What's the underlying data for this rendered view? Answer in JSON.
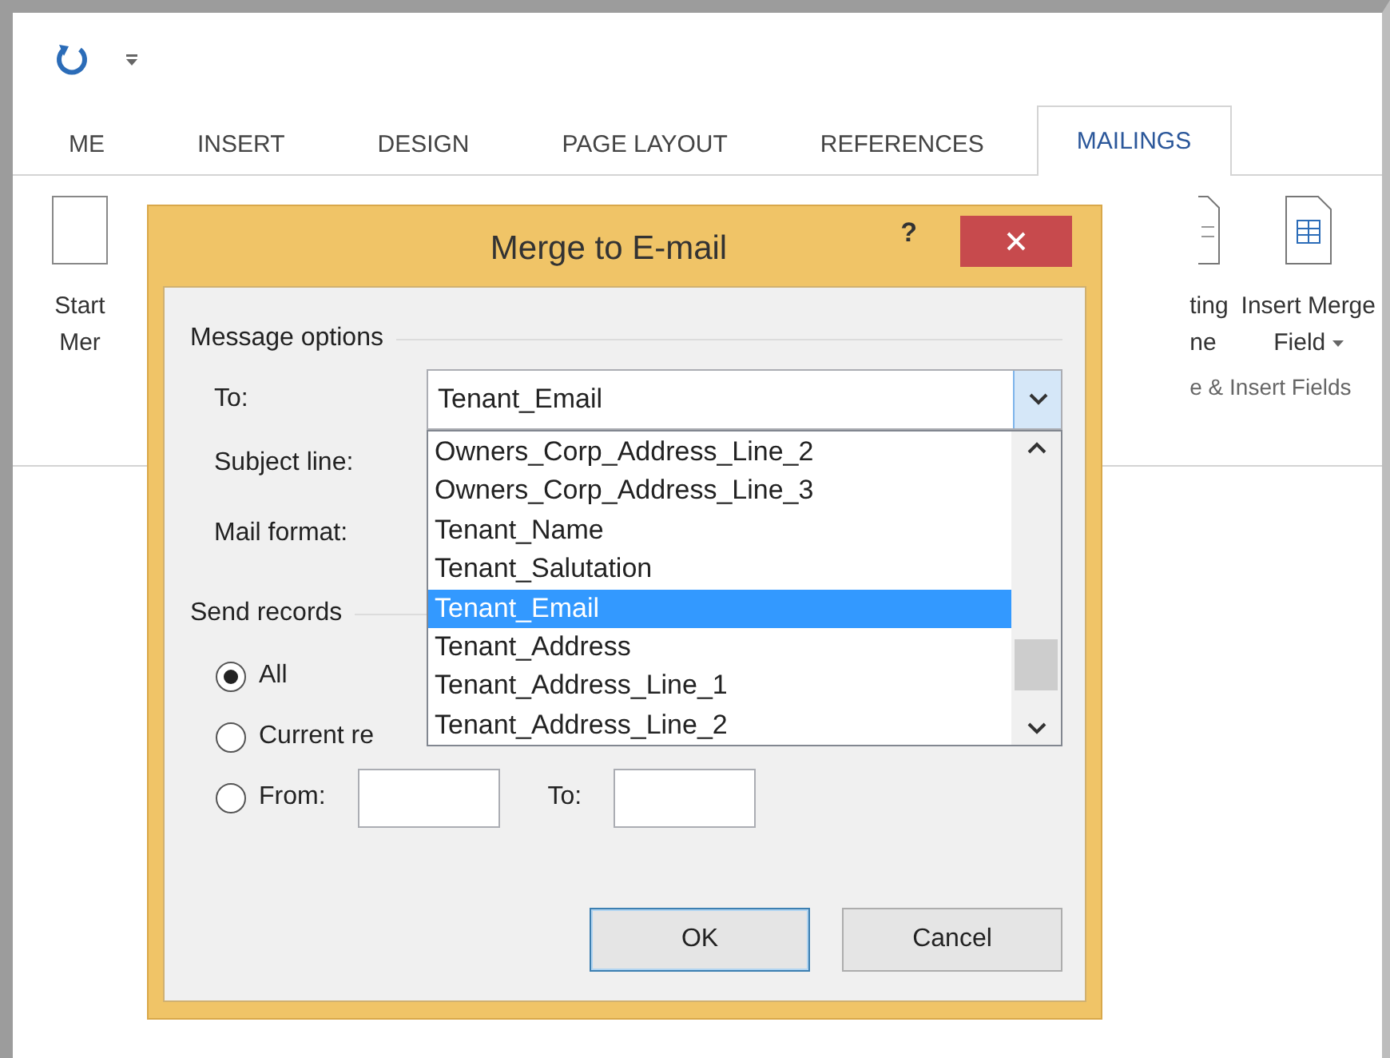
{
  "tabs": [
    {
      "label": "ME",
      "selected": false
    },
    {
      "label": "INSERT",
      "selected": false
    },
    {
      "label": "DESIGN",
      "selected": false
    },
    {
      "label": "PAGE LAYOUT",
      "selected": false
    },
    {
      "label": "REFERENCES",
      "selected": false
    },
    {
      "label": "MAILINGS",
      "selected": true
    }
  ],
  "ribbon": {
    "left_command": {
      "lines": [
        "Start",
        "Mer"
      ]
    },
    "right_commands": [
      {
        "kind": "partial",
        "lines": [
          "ting",
          "ne"
        ]
      },
      {
        "kind": "menu",
        "lines": [
          "Insert Merge",
          "Field"
        ]
      }
    ],
    "group_label": "e & Insert Fields"
  },
  "dialog": {
    "title": "Merge to E-mail",
    "help": "?",
    "message_options": {
      "legend": "Message options",
      "to": {
        "label": "To:",
        "value": "Tenant_Email"
      },
      "subject_label": "Subject line:",
      "mail_format_label": "Mail format:",
      "list": [
        {
          "label": "Owners_Corp_Address_Line_2",
          "selected": false
        },
        {
          "label": "Owners_Corp_Address_Line_3",
          "selected": false
        },
        {
          "label": "Tenant_Name",
          "selected": false
        },
        {
          "label": "Tenant_Salutation",
          "selected": false
        },
        {
          "label": "Tenant_Email",
          "selected": true
        },
        {
          "label": "Tenant_Address",
          "selected": false
        },
        {
          "label": "Tenant_Address_Line_1",
          "selected": false
        },
        {
          "label": "Tenant_Address_Line_2",
          "selected": false
        }
      ]
    },
    "send_records": {
      "legend": "Send records",
      "options": [
        {
          "label": "All",
          "selected": true
        },
        {
          "label": "Current re",
          "selected": false
        },
        {
          "label": "From:",
          "selected": false
        }
      ],
      "to_label": "To:"
    },
    "buttons": [
      {
        "label": "OK",
        "default": true
      },
      {
        "label": "Cancel",
        "default": false
      }
    ]
  }
}
